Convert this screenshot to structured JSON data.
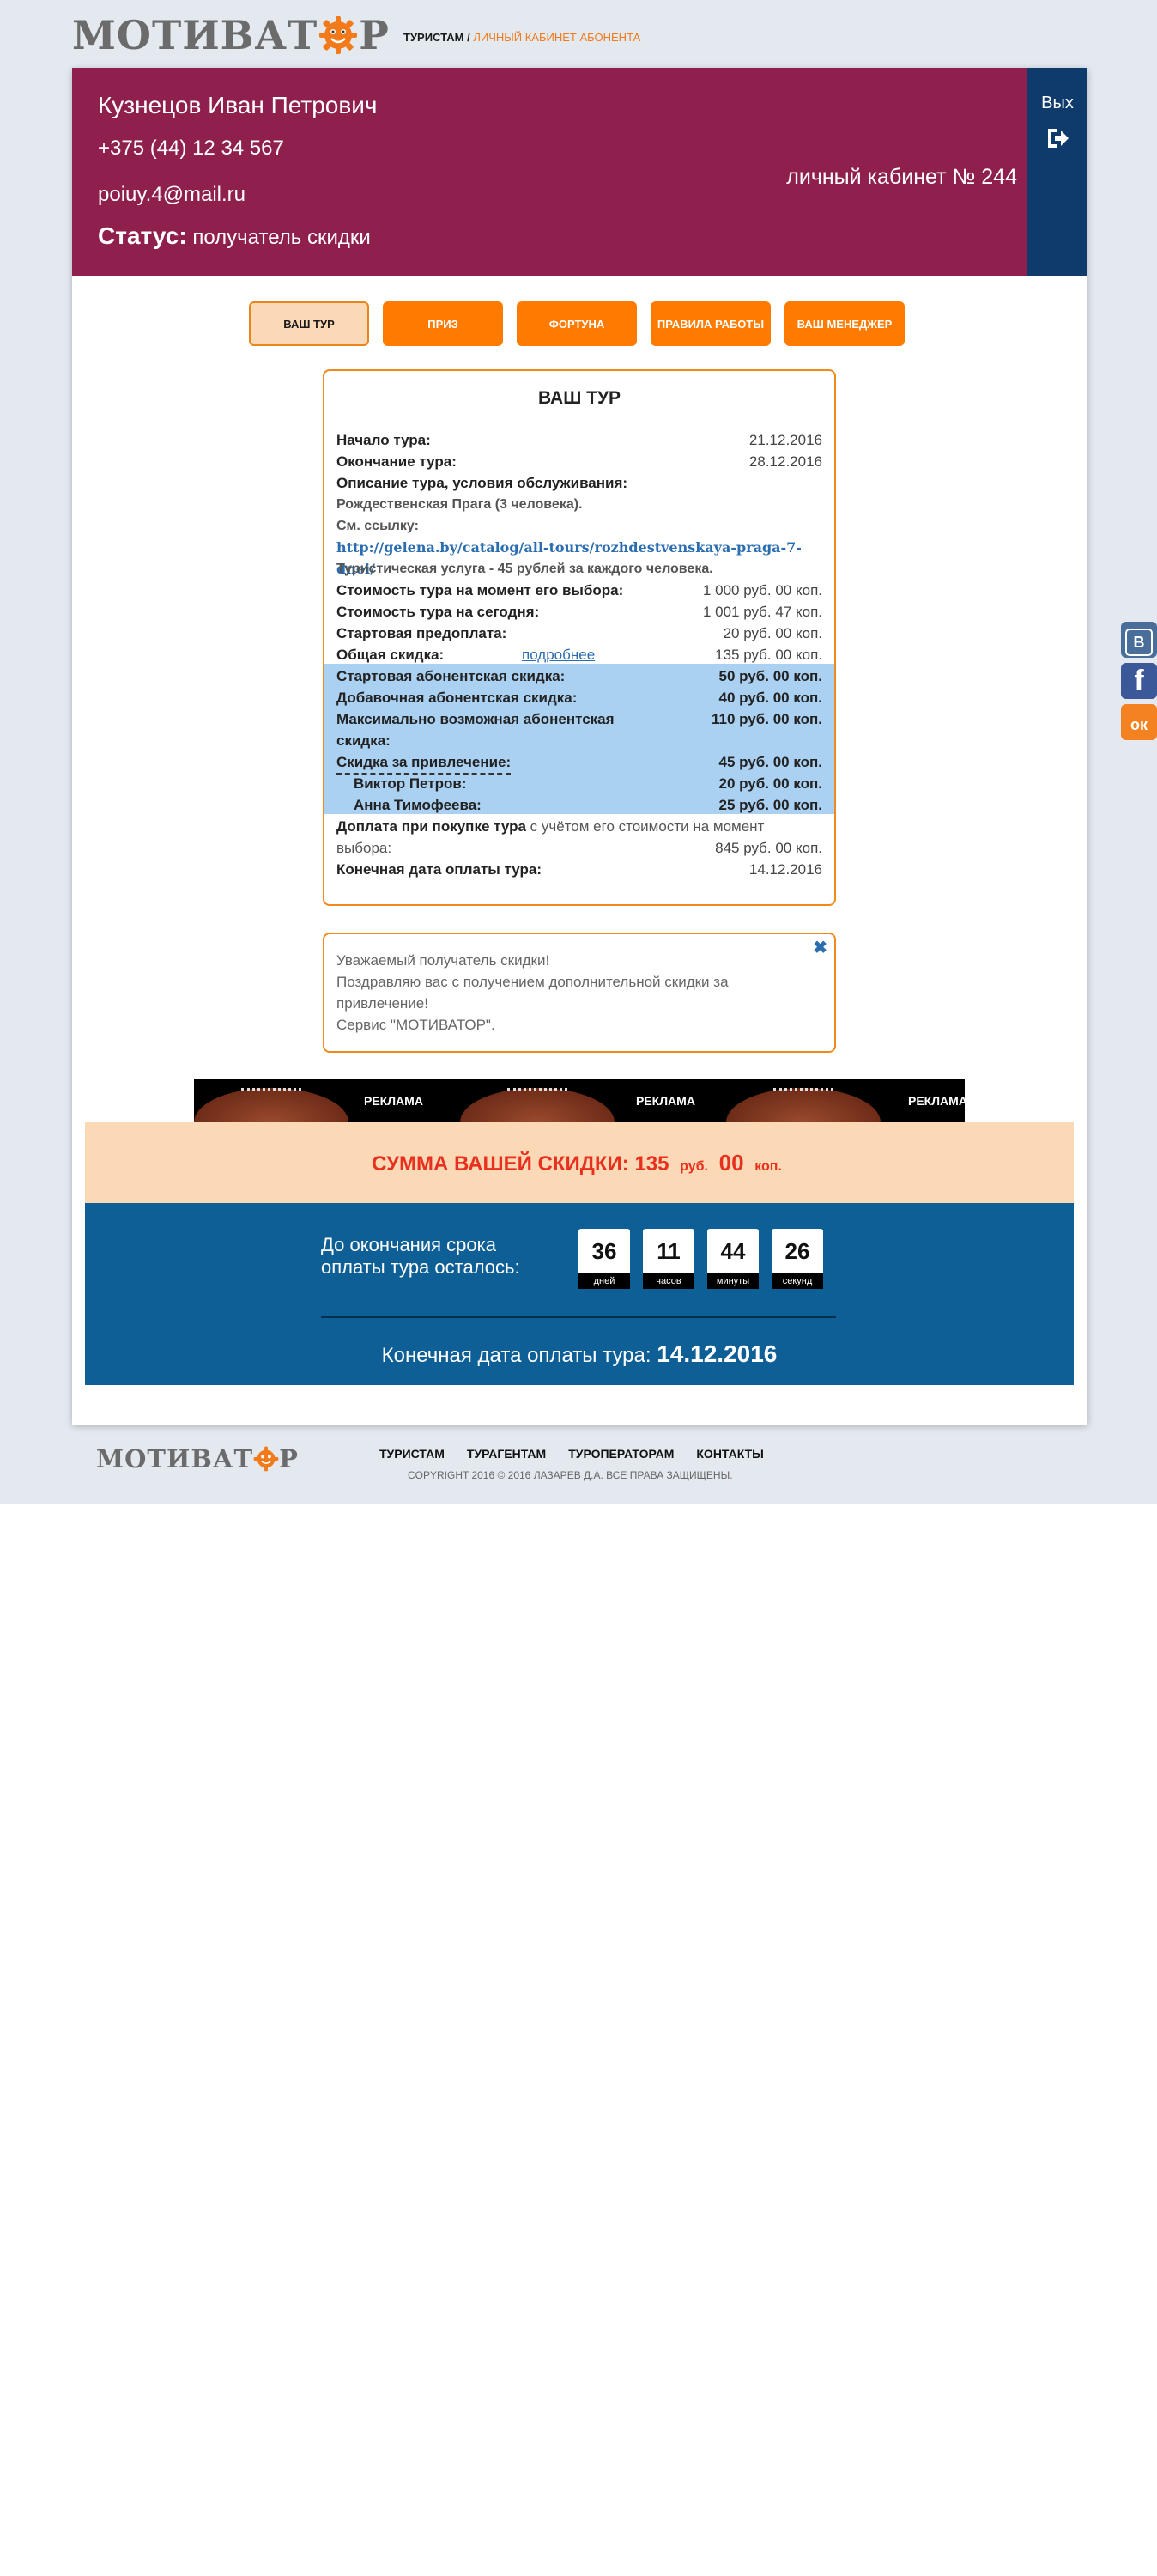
{
  "header": {
    "logo_left": "МОТИВАТ",
    "logo_right": "Р",
    "breadcrumb_parent": "ТУРИСТАМ",
    "breadcrumb_sep": "/",
    "breadcrumb_current": "ЛИЧНЫЙ КАБИНЕТ АБОНЕНТА"
  },
  "profile": {
    "name": "Кузнецов Иван Петрович",
    "phone": "+375 (44) 12 34 567",
    "email": "poiuy.4@mail.ru",
    "status_label": "Статус:",
    "status_value": "получатель скидки",
    "cabinet": "личный кабинет № 244",
    "exit_label": "Вых"
  },
  "tabs": [
    "ВАШ ТУР",
    "ПРИЗ",
    "ФОРТУНА",
    "ПРАВИЛА РАБОТЫ",
    "ВАШ МЕНЕДЖЕР"
  ],
  "tour": {
    "title": "ВАШ ТУР",
    "start_label": "Начало тура:",
    "start_value": "21.12.2016",
    "end_label": "Окончание тура:",
    "end_value": "28.12.2016",
    "desc_label": "Описание тура, условия обслуживания:",
    "desc_text": "Рождественская Прага (3 человека).",
    "see_link": "См. ссылку:",
    "url": "http://gelena.by/catalog/all-tours/rozhdestvenskaya-praga-7-dnei/",
    "service_note": "Туристическая услуга - 45 рублей за каждого человека.",
    "price_choice_label": "Стоимость тура на момент его выбора:",
    "price_choice_value": "1 000 руб. 00 коп.",
    "price_today_label": "Стоимость тура на сегодня:",
    "price_today_value": "1 001 руб. 47 коп.",
    "prepay_label": "Стартовая предоплата:",
    "prepay_value": "20 руб. 00 коп.",
    "total_disc_label": "Общая скидка:",
    "more_link": "подробнее",
    "total_disc_value": "135 руб. 00 коп.",
    "start_disc_label": "Стартовая абонентская скидка:",
    "start_disc_value": "50 руб. 00 коп.",
    "add_disc_label": "Добавочная абонентская скидка:",
    "add_disc_value": "40 руб. 00 коп.",
    "max_disc_label_1": "Максимально возможная абонентская",
    "max_disc_label_2": "скидка:",
    "max_disc_value": "110 руб. 00 коп.",
    "ref_disc_label": "Скидка за привлечение:",
    "ref_disc_value": "45 руб. 00 коп.",
    "ref1_label": "Виктор Петров:",
    "ref1_value": "20 руб. 00 коп.",
    "ref2_label": "Анна Тимофеева:",
    "ref2_value": "25 руб. 00 коп.",
    "extra_label_bold": "Доплата при покупке тура",
    "extra_label_rest": " с учётом его стоимости на момент",
    "extra_label_2": "выбора:",
    "extra_value": "845 руб. 00 коп.",
    "deadline_label": "Конечная дата оплаты тура:",
    "deadline_value": "14.12.2016"
  },
  "message": {
    "line1": "Уважаемый получатель скидки!",
    "line2": "Поздравляю вас с получением дополнительной скидки за",
    "line3": "привлечение!",
    "line4": "Сервис \"МОТИВАТОР\"."
  },
  "ad": {
    "label": "РЕКЛАМА"
  },
  "discount": {
    "label": "СУММА ВАШЕЙ СКИДКИ:",
    "rub": "135",
    "rub_unit": "руб.",
    "kop": "00",
    "kop_unit": "коп."
  },
  "countdown": {
    "text": "До окончания срока оплаты тура осталось:",
    "days": "36",
    "days_unit": "дней",
    "hours": "11",
    "hours_unit": "часов",
    "minutes": "44",
    "minutes_unit": "минуты",
    "seconds": "26",
    "seconds_unit": "секунд",
    "final_label": "Конечная дата оплаты тура:",
    "final_value": "14.12.2016"
  },
  "footer": {
    "nav": [
      "ТУРИСТАМ",
      "ТУРАГЕНТАМ",
      "ТУРОПЕРАТОРАМ",
      "КОНТАКТЫ"
    ],
    "copyright": "COPYRIGHT 2016 © 2016 ЛАЗАРЕВ Д.А. ВСЕ ПРАВА ЗАЩИЩЕНЫ."
  },
  "social": {
    "vk": "В",
    "fb": "f",
    "ok": "ок"
  },
  "colors": {
    "brand_orange": "#ff7a00",
    "profile_bg": "#8f1f4d",
    "exit_bg": "#0e3b6b",
    "countdown_bg": "#0f5f97",
    "highlight": "#abd1f2"
  }
}
